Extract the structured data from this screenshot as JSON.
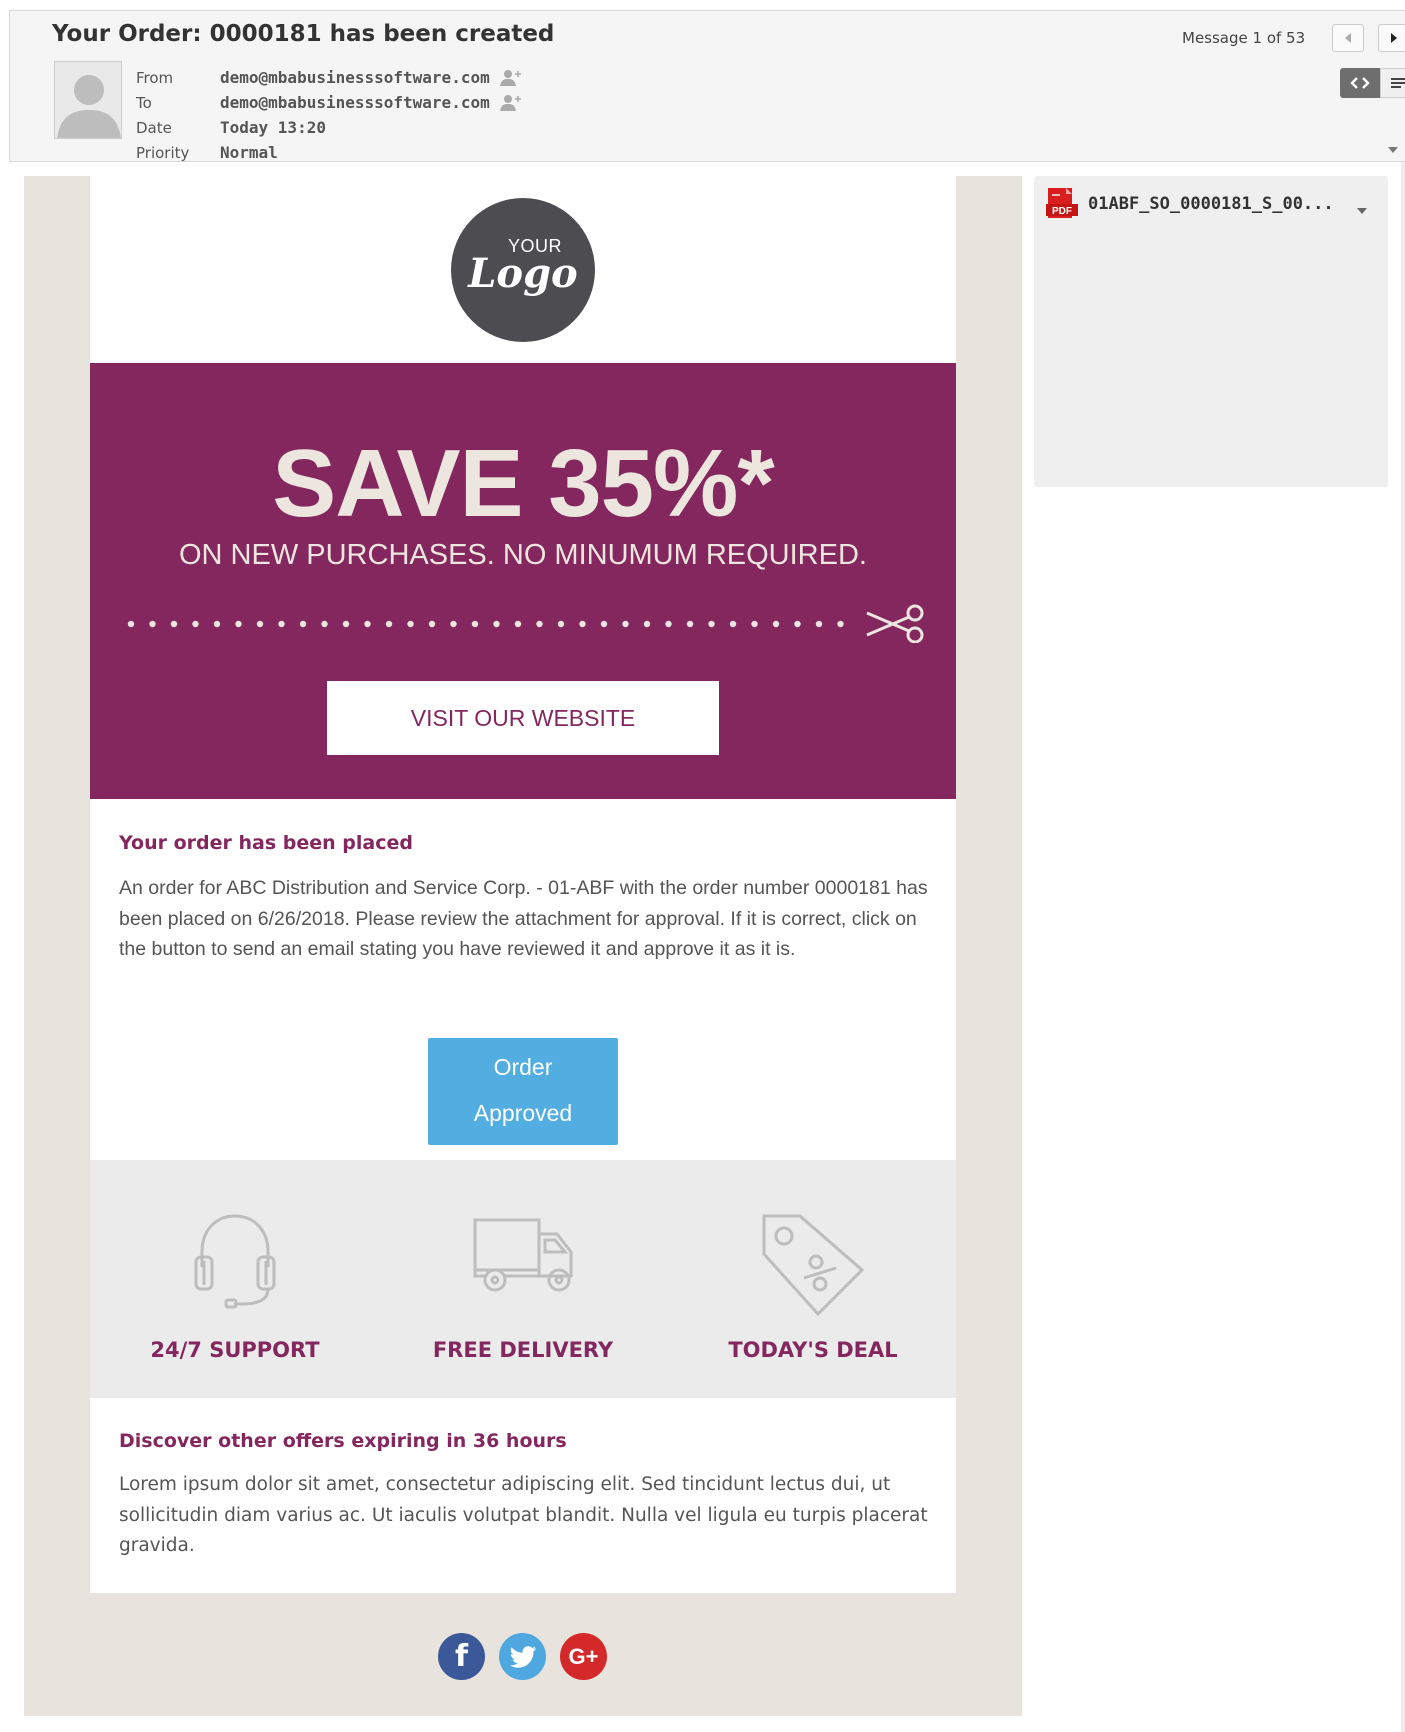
{
  "header": {
    "subject": "Your Order: 0000181 has been created",
    "fields": [
      {
        "key": "From",
        "value": "demo@mbabusinesssoftware.com",
        "add_contact": true
      },
      {
        "key": "To",
        "value": "demo@mbabusinesssoftware.com",
        "add_contact": true
      },
      {
        "key": "Date",
        "value": "Today 13:20",
        "add_contact": false
      },
      {
        "key": "Priority",
        "value": "Normal",
        "add_contact": false
      }
    ],
    "message_count": "Message 1 of 53"
  },
  "email": {
    "logo_top": "YOUR",
    "logo_word": "Logo",
    "save_headline": "SAVE 35%*",
    "save_subline": "ON NEW PURCHASES. NO MINUMUM REQUIRED.",
    "visit_button": "VISIT OUR WEBSITE",
    "order_title": "Your order has been placed",
    "order_text": "An order for ABC Distribution and Service Corp. - 01-ABF with the order number 0000181 has been placed on 6/26/2018. Please review the attachment for approval. If it is correct, click on the button to send an email stating you have reviewed it and approve it as it is.",
    "approve_line1": "Order",
    "approve_line2": "Approved",
    "features": [
      {
        "label": "24/7 SUPPORT",
        "icon": "headset-icon"
      },
      {
        "label": "FREE DELIVERY",
        "icon": "truck-icon"
      },
      {
        "label": "TODAY'S DEAL",
        "icon": "tag-percent-icon"
      }
    ],
    "offers_title": "Discover other offers expiring in 36 hours",
    "offers_text": "Lorem ipsum dolor sit amet, consectetur adipiscing elit. Sed tincidunt lectus dui, ut sollicitudin diam varius ac. Ut iaculis volutpat blandit. Nulla vel ligula eu turpis placerat gravida.",
    "social": [
      {
        "name": "facebook",
        "glyph": "f",
        "color": "#3b5998"
      },
      {
        "name": "twitter",
        "glyph": "t",
        "color": "#4fa7e0"
      },
      {
        "name": "google-plus",
        "glyph": "G+",
        "color": "#d3292a"
      }
    ]
  },
  "attachment": {
    "icon_text": "PDF",
    "filename": "01ABF_SO_0000181_S_00..."
  },
  "colors": {
    "brand_purple": "#83275e",
    "cream": "#ece6de",
    "approve_blue": "#52ade0",
    "frame_beige": "#e8e3dd"
  }
}
